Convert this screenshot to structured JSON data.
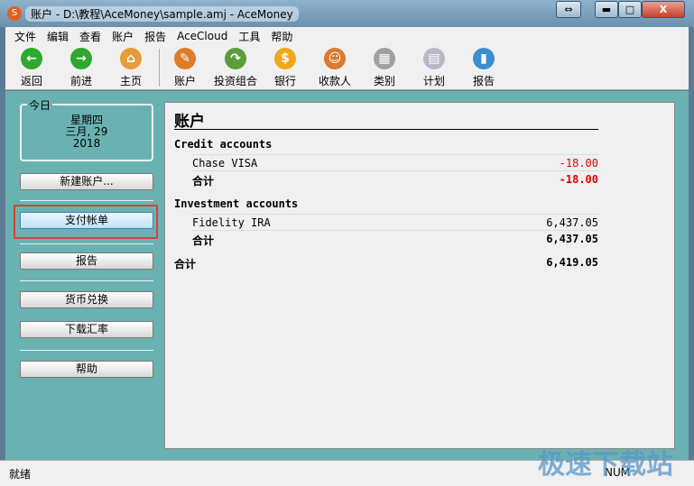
{
  "window": {
    "title": "账户 - D:\\教程\\AceMoney\\sample.amj - AceMoney",
    "restore": "⇔",
    "minimize": "▬",
    "maximize": "□",
    "close": "X"
  },
  "menu": [
    "文件",
    "编辑",
    "查看",
    "账户",
    "报告",
    "AceCloud",
    "工具",
    "帮助"
  ],
  "toolbar": [
    {
      "label": "返回",
      "icon": "back-arrow-icon",
      "color": "#2ea82e",
      "glyph": "←"
    },
    {
      "label": "前进",
      "icon": "forward-arrow-icon",
      "color": "#2ea82e",
      "glyph": "→"
    },
    {
      "label": "主页",
      "icon": "home-icon",
      "color": "#e89b3a",
      "glyph": "⌂"
    },
    {
      "label": "账户",
      "icon": "account-book-icon",
      "color": "#e07b2a",
      "glyph": "✎"
    },
    {
      "label": "投资组合",
      "icon": "portfolio-icon",
      "color": "#5a9e3a",
      "glyph": "↷"
    },
    {
      "label": "银行",
      "icon": "bank-coin-icon",
      "color": "#f0a818",
      "glyph": "$"
    },
    {
      "label": "收款人",
      "icon": "payee-icon",
      "color": "#d87a30",
      "glyph": "☺"
    },
    {
      "label": "类别",
      "icon": "category-icon",
      "color": "#a0a0a0",
      "glyph": "▦"
    },
    {
      "label": "计划",
      "icon": "calendar-icon",
      "color": "#b8b8c8",
      "glyph": "▤"
    },
    {
      "label": "报告",
      "icon": "report-chart-icon",
      "color": "#3a8ed0",
      "glyph": "▮"
    }
  ],
  "sidebar": {
    "today_label": "今日",
    "weekday": "星期四",
    "date": "三月, 29",
    "year": "2018",
    "buttons": [
      "新建账户...",
      "支付帐单",
      "报告",
      "货币兑换",
      "下载汇率",
      "帮助"
    ]
  },
  "content": {
    "title": "账户",
    "groups": [
      {
        "name": "Credit accounts",
        "items": [
          {
            "name": "Chase VISA",
            "value": "-18.00"
          }
        ],
        "total_label": "合计",
        "total": "-18.00"
      },
      {
        "name": "Investment accounts",
        "items": [
          {
            "name": "Fidelity IRA",
            "value": "6,437.05"
          }
        ],
        "total_label": "合计",
        "total": "6,437.05"
      }
    ],
    "grand_total_label": "合计",
    "grand_total": "6,419.05",
    "negative_color": "#e00000"
  },
  "status": {
    "text": "就绪",
    "num": "NUM"
  },
  "watermark": "极速下载站"
}
